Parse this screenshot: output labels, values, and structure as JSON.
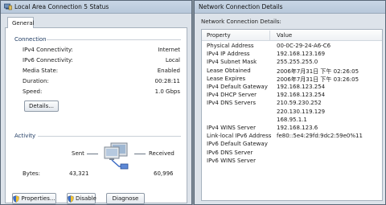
{
  "status_window": {
    "title": "Local Area Connection 5 Status",
    "tab": "General",
    "connection": {
      "heading": "Connection",
      "rows": [
        {
          "label": "IPv4 Connectivity:",
          "value": "Internet"
        },
        {
          "label": "IPv6 Connectivity:",
          "value": "Local"
        },
        {
          "label": "Media State:",
          "value": "Enabled"
        },
        {
          "label": "Duration:",
          "value": "00:28:11"
        },
        {
          "label": "Speed:",
          "value": "1.0 Gbps"
        }
      ],
      "details_button": "Details..."
    },
    "activity": {
      "heading": "Activity",
      "sent_label": "Sent",
      "received_label": "Received",
      "bytes_label": "Bytes:",
      "bytes_sent": "43,321",
      "bytes_received": "60,996"
    },
    "buttons": {
      "properties": "Properties...",
      "disable": "Disable",
      "diagnose": "Diagnose"
    }
  },
  "details_window": {
    "title": "Network Connection Details",
    "caption": "Network Connection Details:",
    "columns": {
      "property": "Property",
      "value": "Value"
    },
    "rows": [
      {
        "property": "Physical Address",
        "value": "00-0C-29-24-A6-C6"
      },
      {
        "property": "IPv4 IP Address",
        "value": "192.168.123.169"
      },
      {
        "property": "IPv4 Subnet Mask",
        "value": "255.255.255.0"
      },
      {
        "property": "Lease Obtained",
        "value": "2006年7月31日 下午 02:26:05"
      },
      {
        "property": "Lease Expires",
        "value": "2006年7月31日 下午 03:26:05"
      },
      {
        "property": "IPv4 Default Gateway",
        "value": "192.168.123.254"
      },
      {
        "property": "IPv4 DHCP Server",
        "value": "192.168.123.254"
      },
      {
        "property": "IPv4 DNS Servers",
        "value": "210.59.230.252"
      },
      {
        "property": "",
        "value": "220.130.119.129"
      },
      {
        "property": "",
        "value": "168.95.1.1"
      },
      {
        "property": "IPv4 WINS Server",
        "value": "192.168.123.6"
      },
      {
        "property": "Link-local IPv6 Address",
        "value": "fe80::5e4:29fd:9dc2:59e0%11"
      },
      {
        "property": "IPv6 Default Gateway",
        "value": ""
      },
      {
        "property": "IPv6 DNS Server",
        "value": ""
      },
      {
        "property": "IPv6 WINS Server",
        "value": ""
      }
    ]
  },
  "icons": {
    "title_icon": "network-adapter-icon",
    "activity_icon": "network-computer-icon",
    "button_icon": "uac-shield-icon"
  }
}
